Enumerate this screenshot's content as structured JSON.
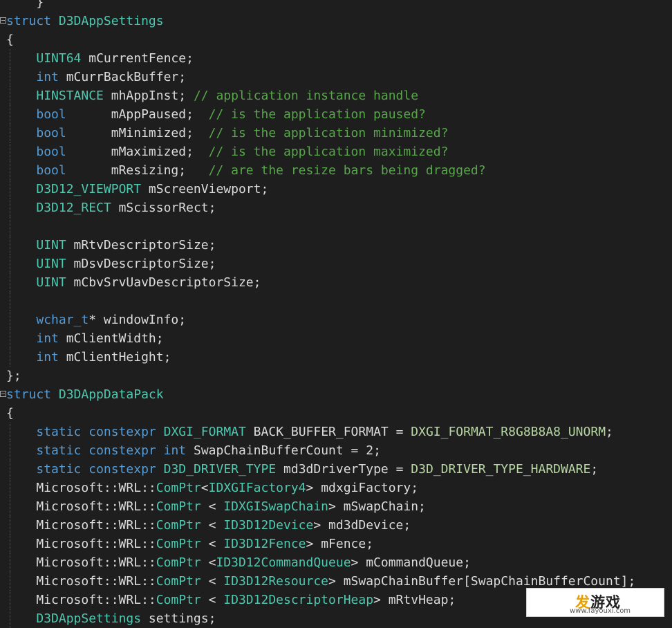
{
  "editor": {
    "lines": [
      {
        "fold": false,
        "guide": false,
        "tokens": [
          {
            "t": "    ",
            "c": "tx"
          },
          {
            "t": "}",
            "c": "tx"
          }
        ]
      },
      {
        "fold": true,
        "guide": false,
        "tokens": [
          {
            "t": "struct",
            "c": "kw"
          },
          {
            "t": " ",
            "c": "tx"
          },
          {
            "t": "D3DAppSettings",
            "c": "ty"
          }
        ]
      },
      {
        "fold": false,
        "guide": false,
        "tokens": [
          {
            "t": "{",
            "c": "tx"
          }
        ]
      },
      {
        "fold": false,
        "guide": true,
        "tokens": [
          {
            "t": "    ",
            "c": "tx"
          },
          {
            "t": "UINT64",
            "c": "ty"
          },
          {
            "t": " mCurrentFence;",
            "c": "tx"
          }
        ]
      },
      {
        "fold": false,
        "guide": true,
        "tokens": [
          {
            "t": "    ",
            "c": "tx"
          },
          {
            "t": "int",
            "c": "kw"
          },
          {
            "t": " mCurrBackBuffer;",
            "c": "tx"
          }
        ]
      },
      {
        "fold": false,
        "guide": true,
        "tokens": [
          {
            "t": "    ",
            "c": "tx"
          },
          {
            "t": "HINSTANCE",
            "c": "ty"
          },
          {
            "t": " mhAppInst; ",
            "c": "tx"
          },
          {
            "t": "// application instance handle",
            "c": "cm"
          }
        ]
      },
      {
        "fold": false,
        "guide": true,
        "tokens": [
          {
            "t": "    ",
            "c": "tx"
          },
          {
            "t": "bool",
            "c": "kw"
          },
          {
            "t": "      mAppPaused;  ",
            "c": "tx"
          },
          {
            "t": "// is the application paused?",
            "c": "cm"
          }
        ]
      },
      {
        "fold": false,
        "guide": true,
        "tokens": [
          {
            "t": "    ",
            "c": "tx"
          },
          {
            "t": "bool",
            "c": "kw"
          },
          {
            "t": "      mMinimized;  ",
            "c": "tx"
          },
          {
            "t": "// is the application minimized?",
            "c": "cm"
          }
        ]
      },
      {
        "fold": false,
        "guide": true,
        "tokens": [
          {
            "t": "    ",
            "c": "tx"
          },
          {
            "t": "bool",
            "c": "kw"
          },
          {
            "t": "      mMaximized;  ",
            "c": "tx"
          },
          {
            "t": "// is the application maximized?",
            "c": "cm"
          }
        ]
      },
      {
        "fold": false,
        "guide": true,
        "tokens": [
          {
            "t": "    ",
            "c": "tx"
          },
          {
            "t": "bool",
            "c": "kw"
          },
          {
            "t": "      mResizing;   ",
            "c": "tx"
          },
          {
            "t": "// are the resize bars being dragged?",
            "c": "cm"
          }
        ]
      },
      {
        "fold": false,
        "guide": true,
        "tokens": [
          {
            "t": "    ",
            "c": "tx"
          },
          {
            "t": "D3D12_VIEWPORT",
            "c": "ty"
          },
          {
            "t": " mScreenViewport;",
            "c": "tx"
          }
        ]
      },
      {
        "fold": false,
        "guide": true,
        "tokens": [
          {
            "t": "    ",
            "c": "tx"
          },
          {
            "t": "D3D12_RECT",
            "c": "ty"
          },
          {
            "t": " mScissorRect;",
            "c": "tx"
          }
        ]
      },
      {
        "fold": false,
        "guide": true,
        "tokens": []
      },
      {
        "fold": false,
        "guide": true,
        "tokens": [
          {
            "t": "    ",
            "c": "tx"
          },
          {
            "t": "UINT",
            "c": "ty"
          },
          {
            "t": " mRtvDescriptorSize;",
            "c": "tx"
          }
        ]
      },
      {
        "fold": false,
        "guide": true,
        "tokens": [
          {
            "t": "    ",
            "c": "tx"
          },
          {
            "t": "UINT",
            "c": "ty"
          },
          {
            "t": " mDsvDescriptorSize;",
            "c": "tx"
          }
        ]
      },
      {
        "fold": false,
        "guide": true,
        "tokens": [
          {
            "t": "    ",
            "c": "tx"
          },
          {
            "t": "UINT",
            "c": "ty"
          },
          {
            "t": " mCbvSrvUavDescriptorSize;",
            "c": "tx"
          }
        ]
      },
      {
        "fold": false,
        "guide": true,
        "tokens": []
      },
      {
        "fold": false,
        "guide": true,
        "tokens": [
          {
            "t": "    ",
            "c": "tx"
          },
          {
            "t": "wchar_t",
            "c": "kw"
          },
          {
            "t": "* windowInfo;",
            "c": "tx"
          }
        ]
      },
      {
        "fold": false,
        "guide": true,
        "tokens": [
          {
            "t": "    ",
            "c": "tx"
          },
          {
            "t": "int",
            "c": "kw"
          },
          {
            "t": " mClientWidth;",
            "c": "tx"
          }
        ]
      },
      {
        "fold": false,
        "guide": true,
        "tokens": [
          {
            "t": "    ",
            "c": "tx"
          },
          {
            "t": "int",
            "c": "kw"
          },
          {
            "t": " mClientHeight;",
            "c": "tx"
          }
        ]
      },
      {
        "fold": false,
        "guide": false,
        "tokens": [
          {
            "t": "};",
            "c": "tx"
          }
        ]
      },
      {
        "fold": true,
        "guide": false,
        "tokens": [
          {
            "t": "struct",
            "c": "kw"
          },
          {
            "t": " ",
            "c": "tx"
          },
          {
            "t": "D3DAppDataPack",
            "c": "ty"
          }
        ]
      },
      {
        "fold": false,
        "guide": false,
        "tokens": [
          {
            "t": "{",
            "c": "tx"
          }
        ]
      },
      {
        "fold": false,
        "guide": true,
        "tokens": [
          {
            "t": "    ",
            "c": "tx"
          },
          {
            "t": "static",
            "c": "kw"
          },
          {
            "t": " ",
            "c": "tx"
          },
          {
            "t": "constexpr",
            "c": "kw"
          },
          {
            "t": " ",
            "c": "tx"
          },
          {
            "t": "DXGI_FORMAT",
            "c": "ty"
          },
          {
            "t": " BACK_BUFFER_FORMAT = ",
            "c": "tx"
          },
          {
            "t": "DXGI_FORMAT_R8G8B8A8_UNORM",
            "c": "mac"
          },
          {
            "t": ";",
            "c": "tx"
          }
        ]
      },
      {
        "fold": false,
        "guide": true,
        "tokens": [
          {
            "t": "    ",
            "c": "tx"
          },
          {
            "t": "static",
            "c": "kw"
          },
          {
            "t": " ",
            "c": "tx"
          },
          {
            "t": "constexpr",
            "c": "kw"
          },
          {
            "t": " ",
            "c": "tx"
          },
          {
            "t": "int",
            "c": "kw"
          },
          {
            "t": " SwapChainBufferCount = 2;",
            "c": "tx"
          }
        ]
      },
      {
        "fold": false,
        "guide": true,
        "tokens": [
          {
            "t": "    ",
            "c": "tx"
          },
          {
            "t": "static",
            "c": "kw"
          },
          {
            "t": " ",
            "c": "tx"
          },
          {
            "t": "constexpr",
            "c": "kw"
          },
          {
            "t": " ",
            "c": "tx"
          },
          {
            "t": "D3D_DRIVER_TYPE",
            "c": "ty"
          },
          {
            "t": " md3dDriverType = ",
            "c": "tx"
          },
          {
            "t": "D3D_DRIVER_TYPE_HARDWARE",
            "c": "mac"
          },
          {
            "t": ";",
            "c": "tx"
          }
        ]
      },
      {
        "fold": false,
        "guide": true,
        "tokens": [
          {
            "t": "    Microsoft::WRL::",
            "c": "tx"
          },
          {
            "t": "ComPtr",
            "c": "ty"
          },
          {
            "t": "<",
            "c": "tx"
          },
          {
            "t": "IDXGIFactory4",
            "c": "ty"
          },
          {
            "t": "> mdxgiFactory;",
            "c": "tx"
          }
        ]
      },
      {
        "fold": false,
        "guide": true,
        "tokens": [
          {
            "t": "    Microsoft::WRL::",
            "c": "tx"
          },
          {
            "t": "ComPtr",
            "c": "ty"
          },
          {
            "t": " < ",
            "c": "tx"
          },
          {
            "t": "IDXGISwapChain",
            "c": "ty"
          },
          {
            "t": "> mSwapChain;",
            "c": "tx"
          }
        ]
      },
      {
        "fold": false,
        "guide": true,
        "tokens": [
          {
            "t": "    Microsoft::WRL::",
            "c": "tx"
          },
          {
            "t": "ComPtr",
            "c": "ty"
          },
          {
            "t": " < ",
            "c": "tx"
          },
          {
            "t": "ID3D12Device",
            "c": "ty"
          },
          {
            "t": "> md3dDevice;",
            "c": "tx"
          }
        ]
      },
      {
        "fold": false,
        "guide": true,
        "tokens": [
          {
            "t": "    Microsoft::WRL::",
            "c": "tx"
          },
          {
            "t": "ComPtr",
            "c": "ty"
          },
          {
            "t": " < ",
            "c": "tx"
          },
          {
            "t": "ID3D12Fence",
            "c": "ty"
          },
          {
            "t": "> mFence;",
            "c": "tx"
          }
        ]
      },
      {
        "fold": false,
        "guide": true,
        "tokens": [
          {
            "t": "    Microsoft::WRL::",
            "c": "tx"
          },
          {
            "t": "ComPtr",
            "c": "ty"
          },
          {
            "t": " <",
            "c": "tx"
          },
          {
            "t": "ID3D12CommandQueue",
            "c": "ty"
          },
          {
            "t": "> mCommandQueue;",
            "c": "tx"
          }
        ]
      },
      {
        "fold": false,
        "guide": true,
        "tokens": [
          {
            "t": "    Microsoft::WRL::",
            "c": "tx"
          },
          {
            "t": "ComPtr",
            "c": "ty"
          },
          {
            "t": " < ",
            "c": "tx"
          },
          {
            "t": "ID3D12Resource",
            "c": "ty"
          },
          {
            "t": "> mSwapChainBuffer[SwapChainBufferCount];",
            "c": "tx"
          }
        ]
      },
      {
        "fold": false,
        "guide": true,
        "tokens": [
          {
            "t": "    Microsoft::WRL::",
            "c": "tx"
          },
          {
            "t": "ComPtr",
            "c": "ty"
          },
          {
            "t": " < ",
            "c": "tx"
          },
          {
            "t": "ID3D12DescriptorHeap",
            "c": "ty"
          },
          {
            "t": "> mRtvHeap;",
            "c": "tx"
          }
        ]
      },
      {
        "fold": false,
        "guide": true,
        "tokens": [
          {
            "t": "    ",
            "c": "tx"
          },
          {
            "t": "D3DAppSettings",
            "c": "ty"
          },
          {
            "t": " settings;",
            "c": "tx"
          }
        ]
      }
    ]
  },
  "watermark": {
    "logo_first": "发",
    "logo_rest": "游戏",
    "url": "www.fayouxi.com"
  }
}
